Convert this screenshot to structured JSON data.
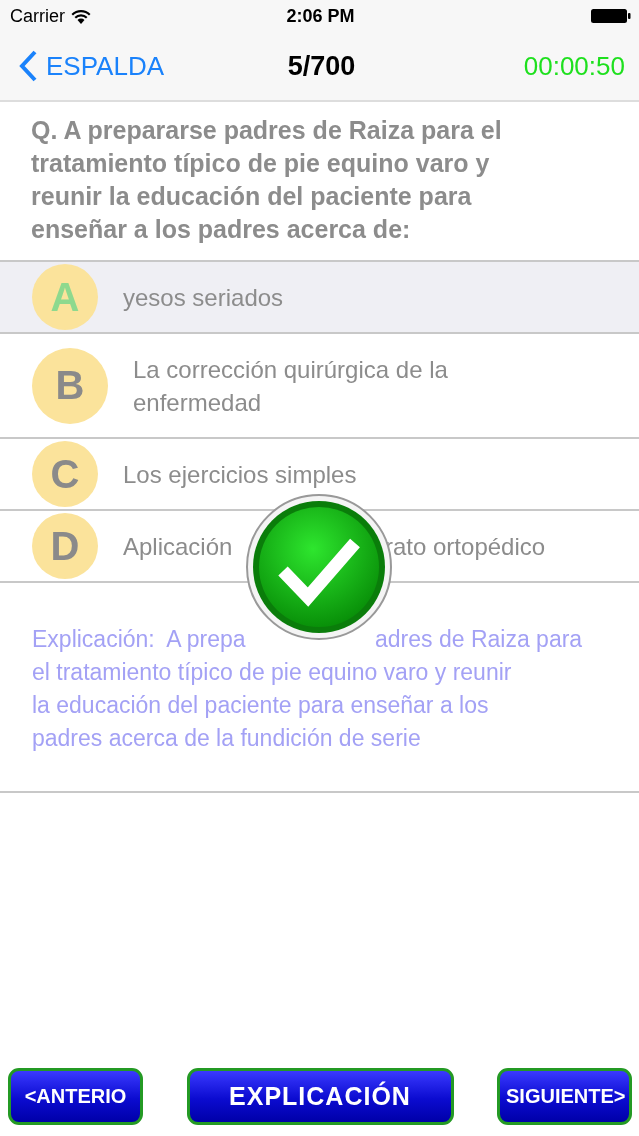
{
  "status_bar": {
    "carrier": "Carrier",
    "time": "2:06 PM"
  },
  "nav": {
    "back": "ESPALDA",
    "title": "5/700",
    "timer": "00:00:50"
  },
  "question": "Q. A prepararse padres de Raiza para el tratamiento típico de pie equino varo y reunir la educación del paciente para enseñar a los padres acerca de:",
  "options": [
    {
      "letter": "A",
      "text_parts": [
        "yesos seriados"
      ],
      "selected": true
    },
    {
      "letter": "B",
      "text_parts": [
        "La corrección quirúrgica de la enfermedad"
      ],
      "selected": false
    },
    {
      "letter": "C",
      "text_parts": [
        "Los ejercicios simples"
      ],
      "selected": false
    },
    {
      "letter": "D",
      "text_parts": [
        "Aplicación",
        "rato ortopédico"
      ],
      "selected": false
    }
  ],
  "result": {
    "kind": "correct"
  },
  "explanation": {
    "first_line_parts": [
      "Explicación:  A prepa",
      "adres de Raiza para"
    ],
    "lines": [
      "el tratamiento típico de pie equino varo y reunir",
      "la educación del paciente para enseñar a los",
      "padres acerca de la fundición de serie"
    ]
  },
  "buttons": [
    "<ANTERIO",
    "EXPLICACIÓN",
    "SIGUIENTE>"
  ]
}
